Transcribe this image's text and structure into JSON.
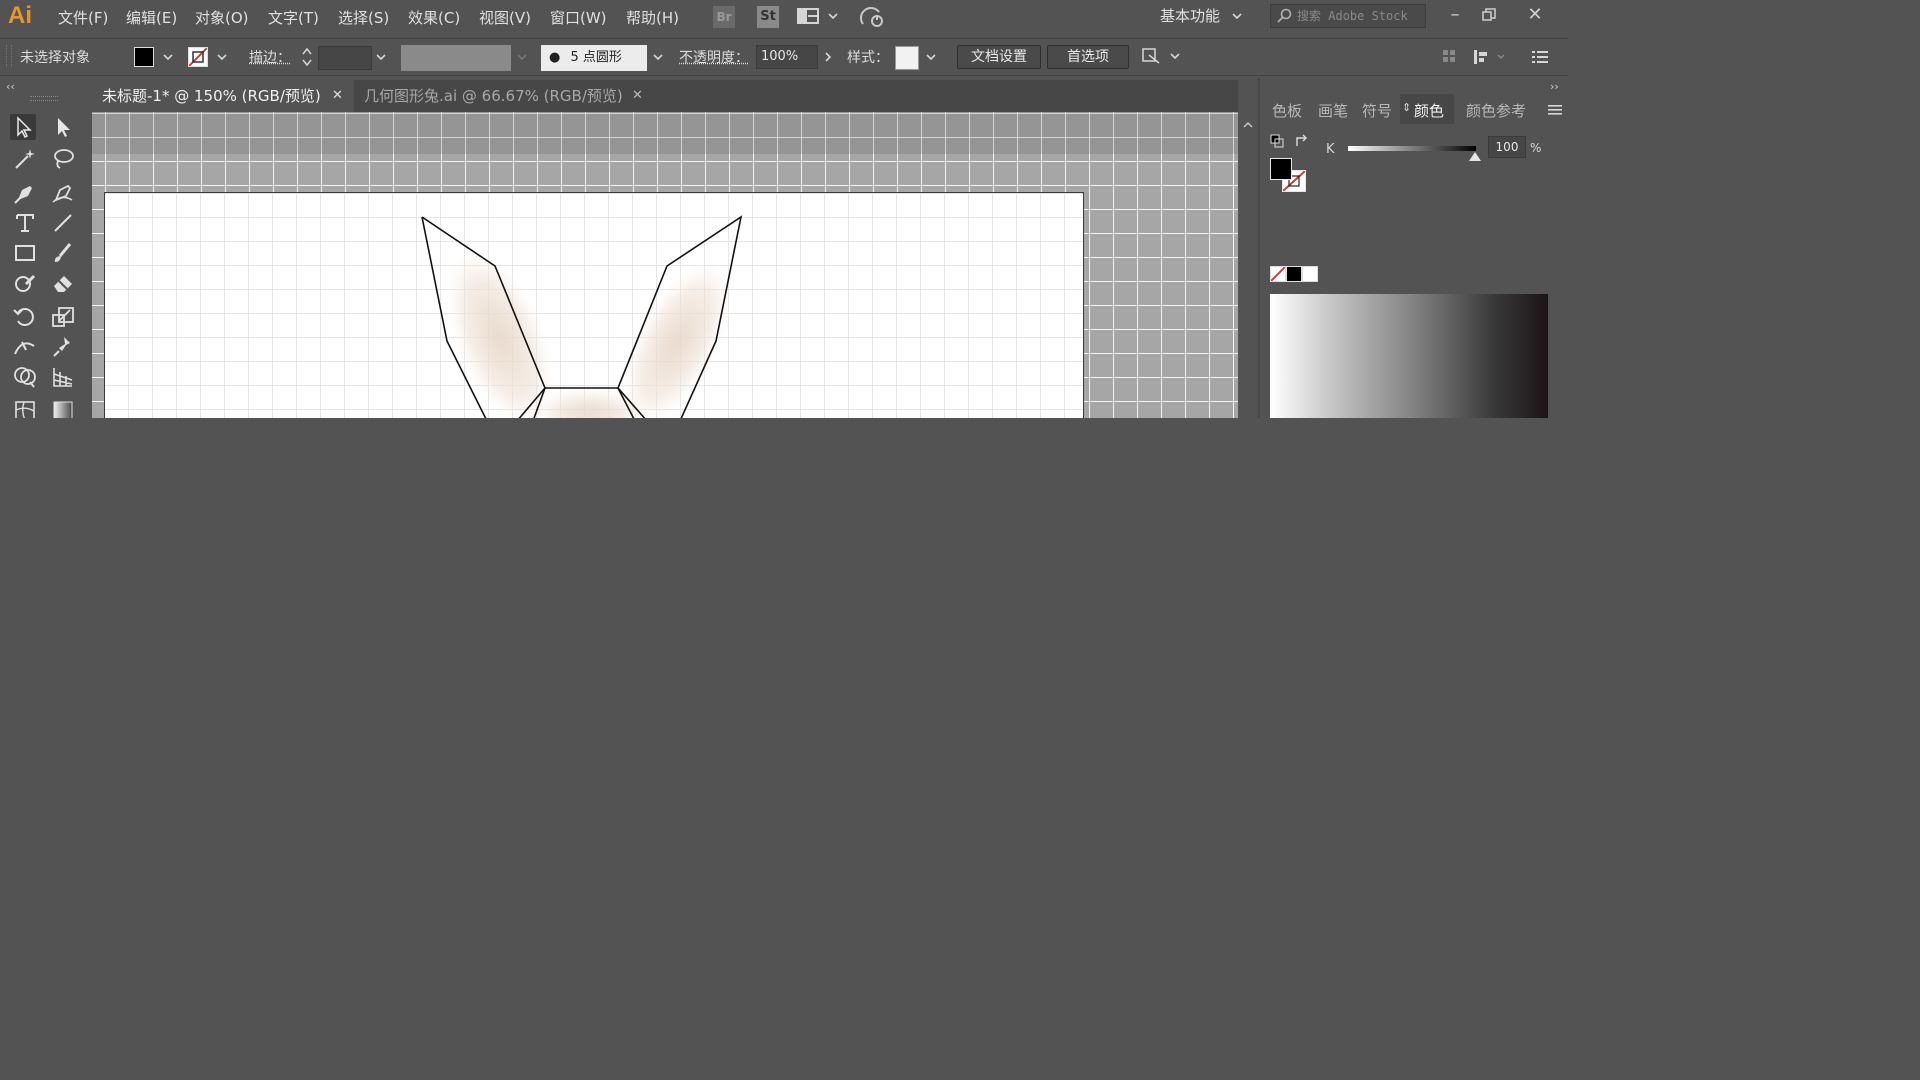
{
  "app": {
    "logo": "Ai"
  },
  "menu": [
    "文件(F)",
    "编辑(E)",
    "对象(O)",
    "文字(T)",
    "选择(S)",
    "效果(C)",
    "视图(V)",
    "窗口(W)",
    "帮助(H)"
  ],
  "menubar_badges": {
    "bridge": "Br",
    "stock": "St"
  },
  "workspace": {
    "label": "基本功能"
  },
  "search": {
    "placeholder": "搜索 Adobe Stock"
  },
  "controlbar": {
    "selection_status": "未选择对象",
    "stroke_label": "描边：",
    "brush_label": "5 点圆形",
    "opacity_label": "不透明度：",
    "opacity_value": "100%",
    "style_label": "样式：",
    "doc_setup_button": "文档设置",
    "preferences_button": "首选项"
  },
  "tabs": [
    {
      "label": "未标题-1* @ 150% (RGB/预览)",
      "active": true
    },
    {
      "label": "几何图形兔.ai @ 66.67% (RGB/预览)",
      "active": false
    }
  ],
  "right_panel": {
    "tabs": [
      "色板",
      "画笔",
      "符号",
      "颜色",
      "颜色参考"
    ],
    "active_tab": "颜色",
    "k_label": "K",
    "k_value": "100",
    "k_unit": "%"
  },
  "colors": {
    "accent_logo": "#e8962c",
    "ui_background": "#535353",
    "artboard": "#ffffff",
    "fill_color": "#000000"
  }
}
